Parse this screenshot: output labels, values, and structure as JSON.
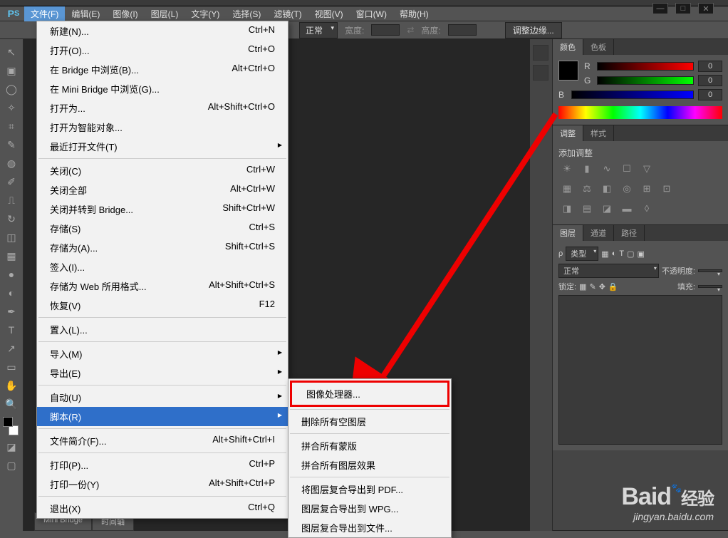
{
  "menubar": {
    "items": [
      "文件(F)",
      "编辑(E)",
      "图像(I)",
      "图层(L)",
      "文字(Y)",
      "选择(S)",
      "滤镜(T)",
      "视图(V)",
      "窗口(W)",
      "帮助(H)"
    ]
  },
  "optionsbar": {
    "mode": "正常",
    "width_label": "宽度:",
    "height_label": "高度:",
    "refine": "调整边缘..."
  },
  "file_menu": [
    {
      "label": "新建(N)...",
      "shortcut": "Ctrl+N"
    },
    {
      "label": "打开(O)...",
      "shortcut": "Ctrl+O"
    },
    {
      "label": "在 Bridge 中浏览(B)...",
      "shortcut": "Alt+Ctrl+O"
    },
    {
      "label": "在 Mini Bridge 中浏览(G)...",
      "shortcut": ""
    },
    {
      "label": "打开为...",
      "shortcut": "Alt+Shift+Ctrl+O"
    },
    {
      "label": "打开为智能对象...",
      "shortcut": ""
    },
    {
      "label": "最近打开文件(T)",
      "shortcut": "",
      "sub": true
    },
    {
      "sep": true
    },
    {
      "label": "关闭(C)",
      "shortcut": "Ctrl+W"
    },
    {
      "label": "关闭全部",
      "shortcut": "Alt+Ctrl+W"
    },
    {
      "label": "关闭并转到 Bridge...",
      "shortcut": "Shift+Ctrl+W"
    },
    {
      "label": "存储(S)",
      "shortcut": "Ctrl+S"
    },
    {
      "label": "存储为(A)...",
      "shortcut": "Shift+Ctrl+S"
    },
    {
      "label": "签入(I)...",
      "shortcut": ""
    },
    {
      "label": "存储为 Web 所用格式...",
      "shortcut": "Alt+Shift+Ctrl+S"
    },
    {
      "label": "恢复(V)",
      "shortcut": "F12"
    },
    {
      "sep": true
    },
    {
      "label": "置入(L)...",
      "shortcut": ""
    },
    {
      "sep": true
    },
    {
      "label": "导入(M)",
      "shortcut": "",
      "sub": true
    },
    {
      "label": "导出(E)",
      "shortcut": "",
      "sub": true
    },
    {
      "sep": true
    },
    {
      "label": "自动(U)",
      "shortcut": "",
      "sub": true
    },
    {
      "label": "脚本(R)",
      "shortcut": "",
      "sub": true,
      "highlight": true
    },
    {
      "sep": true
    },
    {
      "label": "文件简介(F)...",
      "shortcut": "Alt+Shift+Ctrl+I"
    },
    {
      "sep": true
    },
    {
      "label": "打印(P)...",
      "shortcut": "Ctrl+P"
    },
    {
      "label": "打印一份(Y)",
      "shortcut": "Alt+Shift+Ctrl+P"
    },
    {
      "sep": true
    },
    {
      "label": "退出(X)",
      "shortcut": "Ctrl+Q"
    }
  ],
  "scripts_submenu": [
    {
      "label": "图像处理器...",
      "boxed": true
    },
    {
      "sep": true
    },
    {
      "label": "删除所有空图层"
    },
    {
      "sep": true
    },
    {
      "label": "拼合所有蒙版"
    },
    {
      "label": "拼合所有图层效果"
    },
    {
      "sep": true
    },
    {
      "label": "将图层复合导出到 PDF..."
    },
    {
      "label": "图层复合导出到 WPG..."
    },
    {
      "label": "图层复合导出到文件..."
    }
  ],
  "panels": {
    "color": {
      "tabs": [
        "颜色",
        "色板"
      ],
      "r": "0",
      "g": "0",
      "b": "0"
    },
    "adjust": {
      "tabs": [
        "调整",
        "样式"
      ],
      "add": "添加调整"
    },
    "layers": {
      "tabs": [
        "图层",
        "通道",
        "路径"
      ],
      "filter": "类型",
      "blend": "正常",
      "opacity_label": "不透明度:",
      "lock_label": "锁定:",
      "fill_label": "填充:"
    }
  },
  "bottom_tabs": [
    "Mini Bridge",
    "时间轴"
  ],
  "watermark": {
    "brand": "Baid",
    "suffix": "经验",
    "url": "jingyan.baidu.com"
  }
}
